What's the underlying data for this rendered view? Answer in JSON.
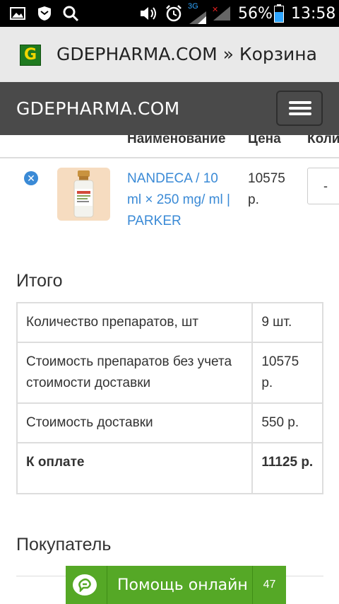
{
  "status_bar": {
    "icons": [
      "gallery-icon",
      "shield-icon",
      "search-icon",
      "volume-icon",
      "alarm-icon",
      "signal-3g-icon",
      "signal-icon",
      "battery-icon"
    ],
    "network_label": "3G",
    "battery": "56%",
    "time": "13:58"
  },
  "browser": {
    "favicon_letter": "G",
    "title": "GDEPHARMA.COM » Корзина"
  },
  "navbar": {
    "brand": "GDEPHARMA.COM",
    "menu_icon": "hamburger-icon"
  },
  "cart": {
    "headers": [
      "Наименование",
      "Цена",
      "Коли"
    ],
    "item": {
      "name": "NANDECA / 10 ml × 250 mg/ ml | PARKER",
      "price": "10575 р.",
      "qty_button": "-"
    }
  },
  "totals": {
    "title": "Итого",
    "rows": [
      {
        "label": "Количество препаратов, шт",
        "value": "9 шт."
      },
      {
        "label": "Стоимость препаратов без учета стоимости доставки",
        "value": "10575 р."
      },
      {
        "label": "Стоимость доставки",
        "value": "550 р."
      },
      {
        "label": "К оплате",
        "value": "11125 р."
      }
    ]
  },
  "buyer": {
    "title": "Покупатель"
  },
  "chat": {
    "label": "Помощь онлайн",
    "count": "47"
  },
  "colors": {
    "navbar": "#4a4a4a",
    "link": "#3a8ad6",
    "chat": "#55a826"
  }
}
